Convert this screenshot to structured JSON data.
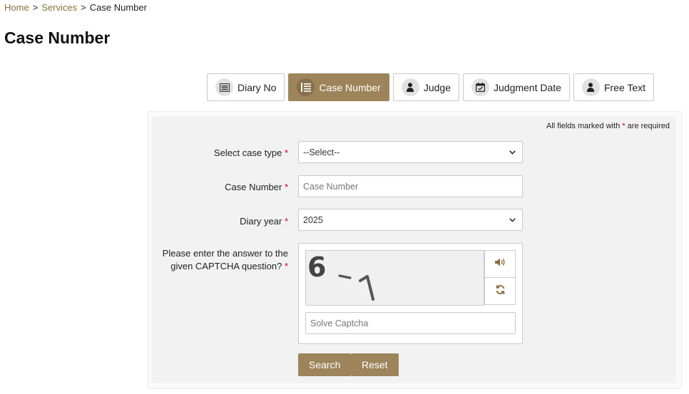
{
  "breadcrumb": {
    "home": "Home",
    "sep1": ">",
    "services": "Services",
    "sep2": ">",
    "current": "Case Number"
  },
  "page_title": "Case Number",
  "tabs": [
    {
      "label": "Diary No",
      "icon": "diary-icon",
      "active": false
    },
    {
      "label": "Case Number",
      "icon": "list-icon",
      "active": true
    },
    {
      "label": "Judge",
      "icon": "person-icon",
      "active": false
    },
    {
      "label": "Judgment Date",
      "icon": "calendar-icon",
      "active": false
    },
    {
      "label": "Free Text",
      "icon": "person-icon",
      "active": false
    }
  ],
  "required_note": {
    "before": "All fields marked with",
    "star": "*",
    "after": "are required"
  },
  "form": {
    "case_type_label": "Select case type",
    "case_type_value": "--Select--",
    "case_number_label": "Case Number",
    "case_number_placeholder": "Case Number",
    "diary_year_label": "Diary year",
    "diary_year_value": "2025",
    "captcha_label_line1": "Please enter the answer to the",
    "captcha_label_line2": "given CAPTCHA question?",
    "captcha_expression": "6 - 1",
    "captcha_placeholder": "Solve Captcha",
    "required_star": "*"
  },
  "buttons": {
    "search": "Search",
    "reset": "Reset"
  },
  "colors": {
    "accent": "#9d845a",
    "link": "#8a6f3e",
    "required": "#d0021b"
  }
}
